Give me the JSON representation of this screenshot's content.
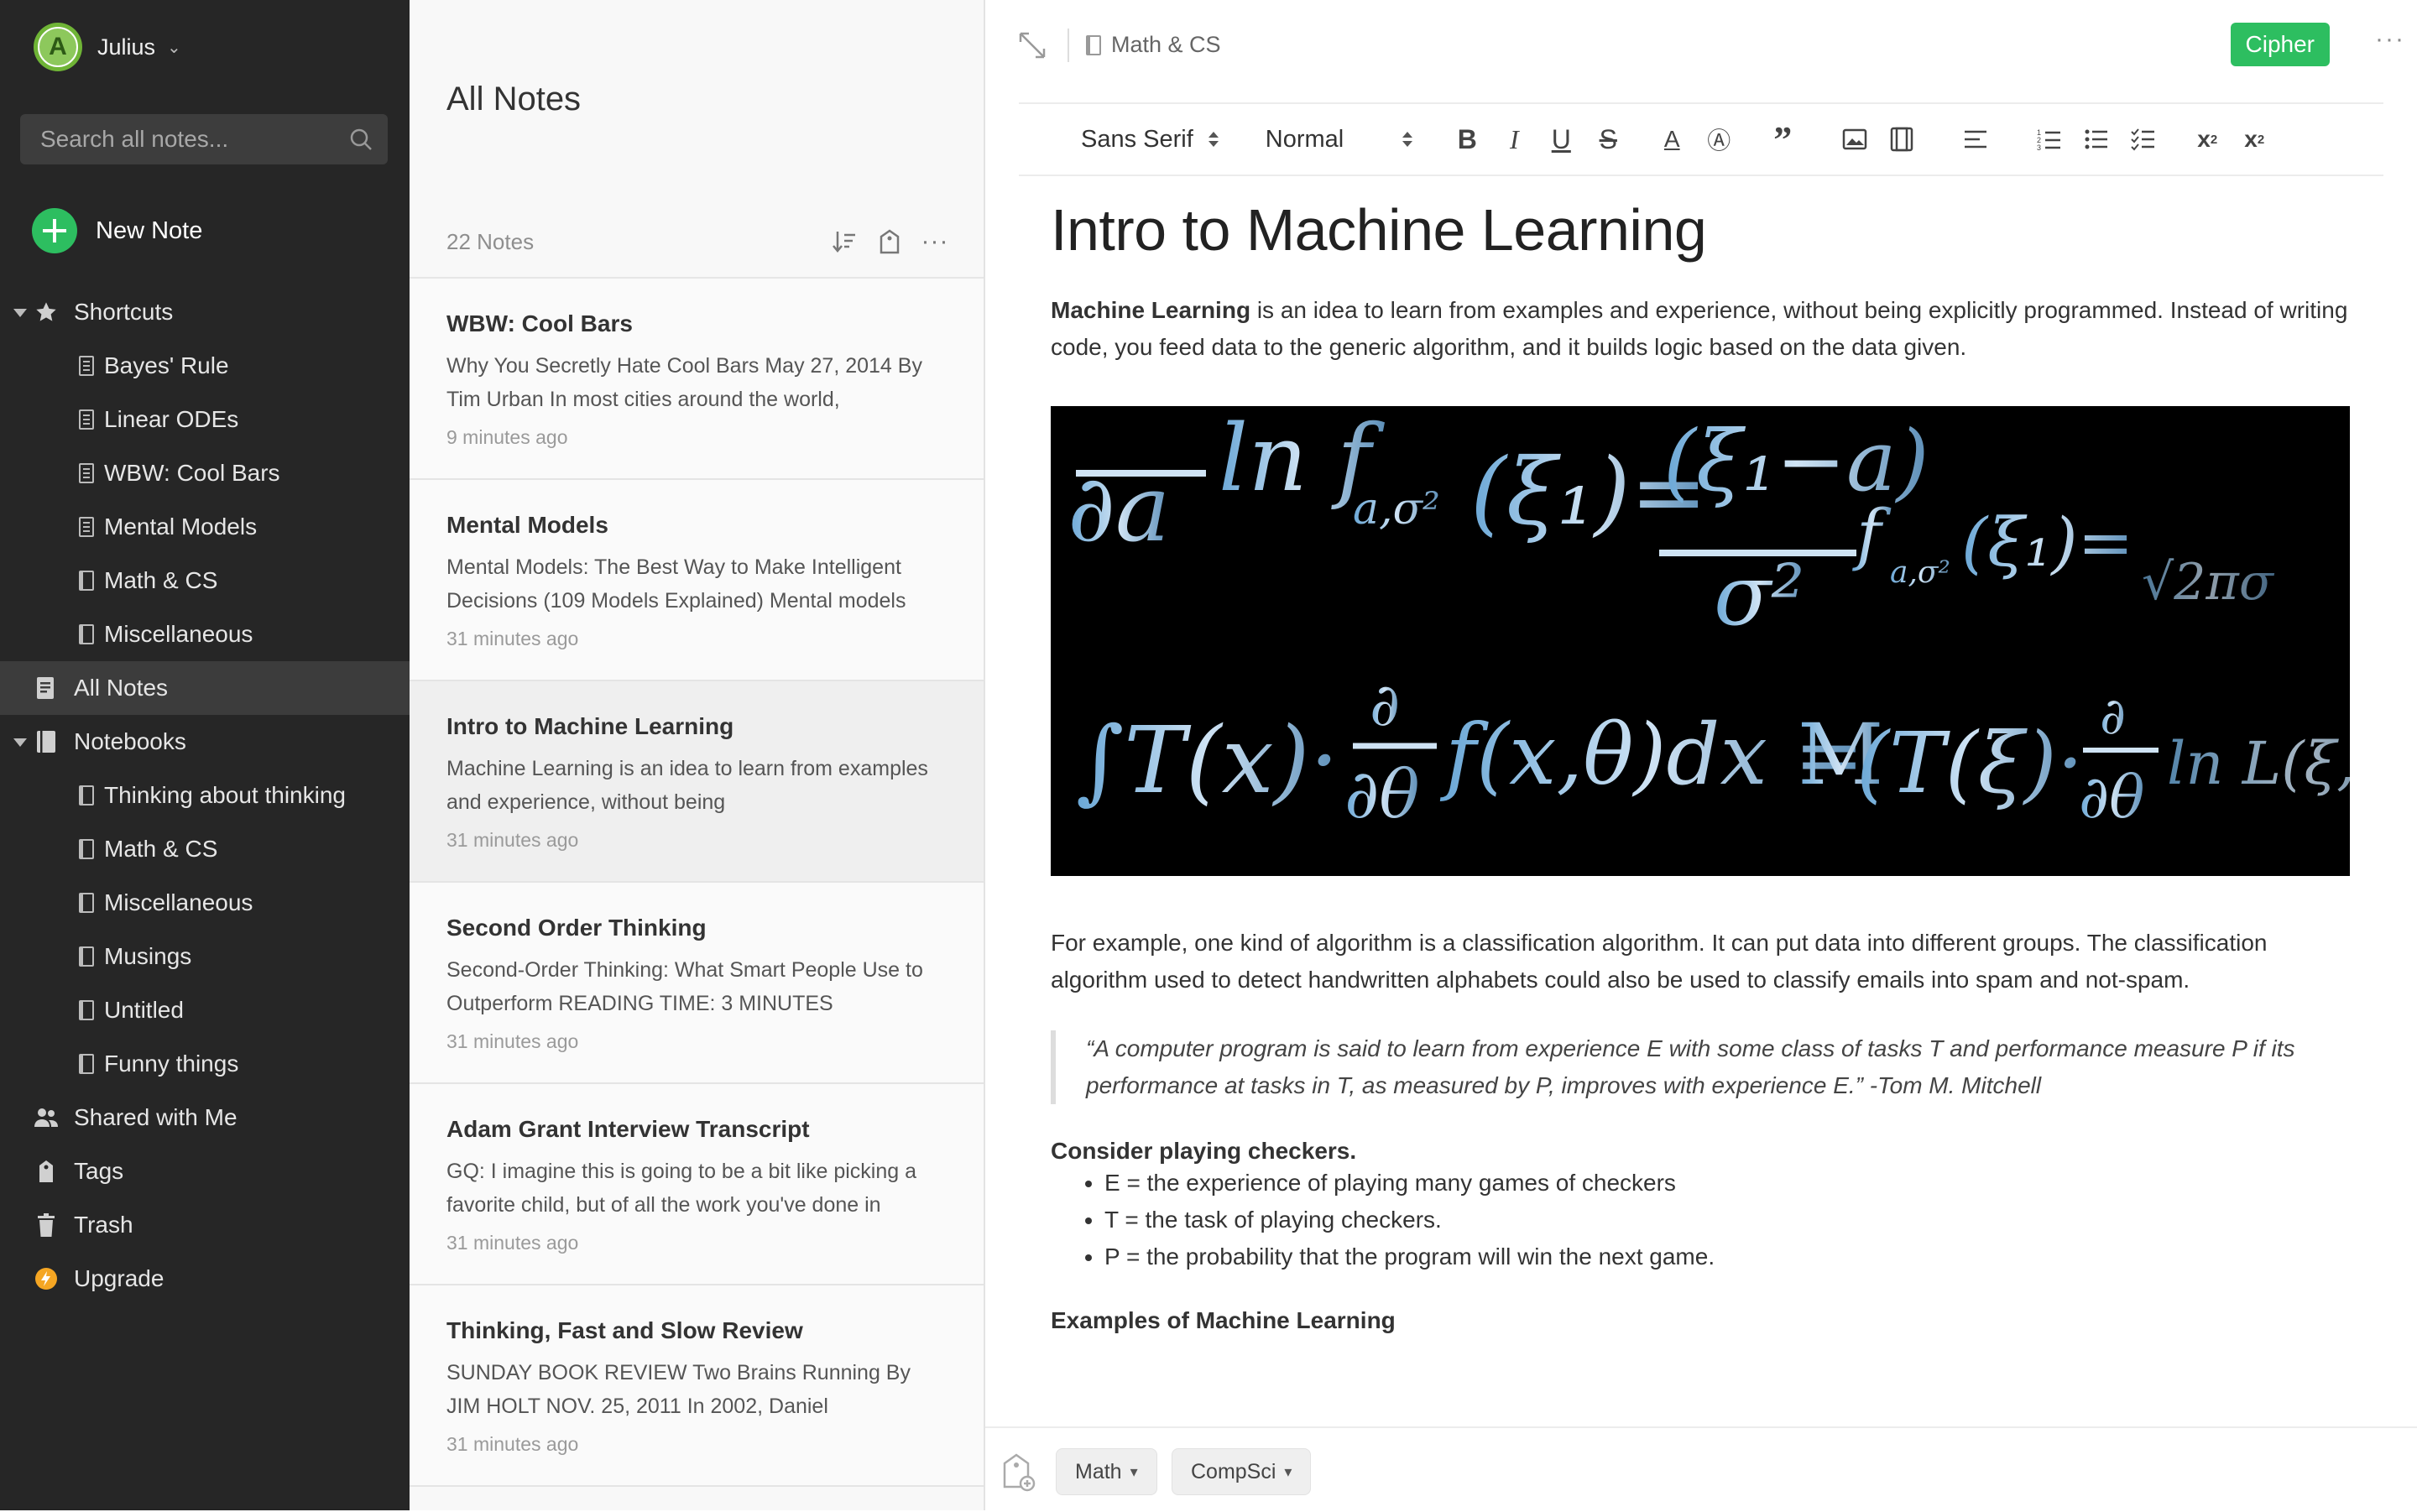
{
  "sidebar": {
    "user": {
      "initial": "A",
      "name": "Julius"
    },
    "search": {
      "placeholder": "Search all notes..."
    },
    "new_note_label": "New Note",
    "shortcuts": {
      "label": "Shortcuts",
      "items": [
        "Bayes' Rule",
        "Linear ODEs",
        "WBW: Cool Bars",
        "Mental Models",
        "Math & CS",
        "Miscellaneous"
      ]
    },
    "all_notes_label": "All Notes",
    "notebooks": {
      "label": "Notebooks",
      "items": [
        "Thinking about thinking",
        "Math & CS",
        "Miscellaneous",
        "Musings",
        "Untitled",
        "Funny things"
      ]
    },
    "shared_label": "Shared with Me",
    "tags_label": "Tags",
    "trash_label": "Trash",
    "upgrade_label": "Upgrade"
  },
  "notelist": {
    "title": "All Notes",
    "count": "22 Notes",
    "notes": [
      {
        "title": "WBW: Cool Bars",
        "snippet": "Why You Secretly Hate Cool Bars May 27, 2014 By Tim Urban In most cities around the world,",
        "time": "9 minutes ago"
      },
      {
        "title": "Mental Models",
        "snippet": "Mental Models: The Best Way to Make Intelligent Decisions (109 Models Explained) Mental models",
        "time": "31 minutes ago"
      },
      {
        "title": "Intro to Machine Learning",
        "snippet": "Machine Learning is an idea to learn from examples and experience, without being",
        "time": "31 minutes ago"
      },
      {
        "title": "Second Order Thinking",
        "snippet": "Second-Order Thinking: What Smart People Use to Outperform READING TIME: 3 MINUTES",
        "time": "31 minutes ago"
      },
      {
        "title": "Adam Grant Interview Transcript",
        "snippet": "GQ: I imagine this is going to be a bit like picking a favorite child, but of all the work you've done in",
        "time": "31 minutes ago"
      },
      {
        "title": "Thinking, Fast and Slow Review",
        "snippet": "SUNDAY BOOK REVIEW Two Brains Running By JIM HOLT NOV. 25, 2011 In 2002, Daniel",
        "time": "31 minutes ago"
      }
    ]
  },
  "editor": {
    "notebook": "Math & CS",
    "share_label": "Cipher",
    "font_family": "Sans Serif",
    "font_size": "Normal",
    "title": "Intro to Machine Learning",
    "intro_bold": "Machine Learning",
    "intro_rest": " is an idea to learn from examples and experience, without being explicitly programmed. Instead of writing code, you feed data to the generic algorithm, and it builds logic based on the data given.",
    "example_para": "For example, one kind of algorithm is a classification algorithm. It can put data into different groups. The classification algorithm used to detect handwritten alphabets could also be used to classify emails into spam and not-spam.",
    "quote": "“A computer program is said to learn from experience E with some class of tasks T and performance measure P if its performance at tasks in T, as measured by P, improves with experience E.” -Tom M. Mitchell",
    "checkers_heading": "Consider playing checkers.",
    "bullets": [
      "E = the experience of playing many games of checkers",
      "T = the task of playing checkers.",
      "P = the probability that the program will win the next game."
    ],
    "next_heading": "Examples of Machine Learning",
    "tags": [
      "Math",
      "CompSci"
    ]
  },
  "colors": {
    "accent_green": "#2dbe60",
    "sidebar_bg": "#262626",
    "upgrade_orange": "#f5a623"
  }
}
